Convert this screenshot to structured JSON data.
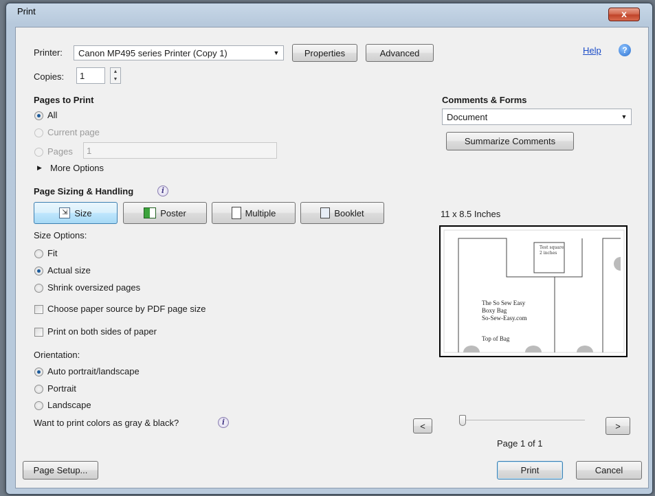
{
  "window": {
    "title": "Print",
    "close_glyph": "x"
  },
  "printer": {
    "label": "Printer:",
    "selected": "Canon MP495 series Printer (Copy 1)",
    "properties_label": "Properties",
    "advanced_label": "Advanced",
    "help_label": "Help"
  },
  "copies": {
    "label": "Copies:",
    "value": "1"
  },
  "pages_to_print": {
    "heading": "Pages to Print",
    "all_label": "All",
    "current_page_label": "Current page",
    "pages_label": "Pages",
    "pages_value": "1",
    "more_options_label": "More Options"
  },
  "sizing": {
    "heading": "Page Sizing & Handling",
    "tabs": [
      "Size",
      "Poster",
      "Multiple",
      "Booklet"
    ],
    "size_options_label": "Size Options:",
    "fit_label": "Fit",
    "actual_size_label": "Actual size",
    "shrink_label": "Shrink oversized pages",
    "paper_source_label": "Choose paper source by PDF page size",
    "both_sides_label": "Print on both sides of paper"
  },
  "orientation": {
    "label": "Orientation:",
    "auto_label": "Auto portrait/landscape",
    "portrait_label": "Portrait",
    "landscape_label": "Landscape"
  },
  "gray_question": "Want to print colors as gray & black?",
  "comments": {
    "heading": "Comments & Forms",
    "selected": "Document",
    "summarize_label": "Summarize Comments"
  },
  "preview": {
    "size_label": "11 x 8.5 Inches",
    "test_square_line1": "Test square",
    "test_square_line2": "2 inches",
    "text_line1": "The So Sew Easy",
    "text_line2": "Boxy Bag",
    "text_line3": "So-Sew-Easy.com",
    "bottom_label": "Top of Bag",
    "prev_label": "<",
    "next_label": ">",
    "page_indicator": "Page 1 of 1"
  },
  "footer": {
    "page_setup_label": "Page Setup...",
    "print_label": "Print",
    "cancel_label": "Cancel"
  },
  "colors": {
    "accent": "#3c7fb1",
    "link": "#1a4cc7",
    "close": "#c0442a"
  }
}
